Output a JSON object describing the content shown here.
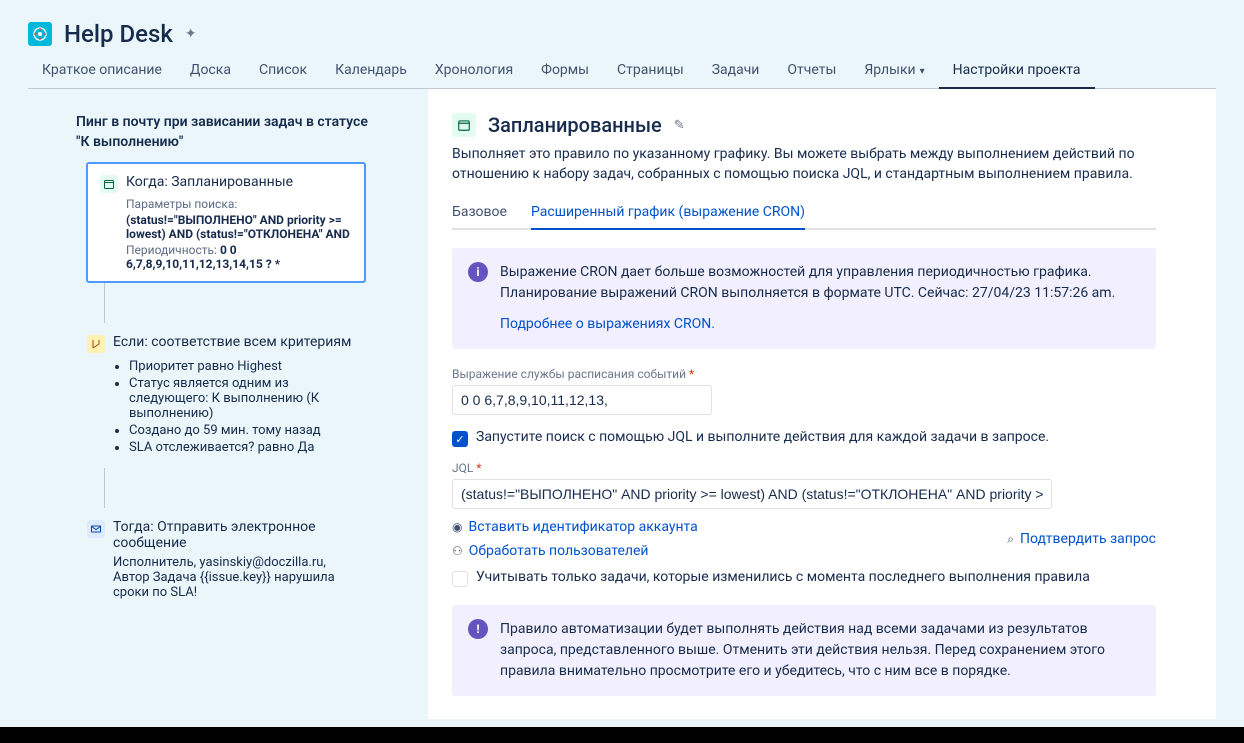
{
  "header": {
    "title": "Help Desk"
  },
  "tabs": {
    "items": [
      "Краткое описание",
      "Доска",
      "Список",
      "Календарь",
      "Хронология",
      "Формы",
      "Страницы",
      "Задачи",
      "Отчеты",
      "Ярлыки",
      "Настройки проекта"
    ],
    "active_index": 10,
    "dropdown_index": 9
  },
  "left": {
    "rule_title": "Пинг в почту при зависании задач в статусе \"К выполнению\"",
    "when": {
      "title": "Когда: Запланированные",
      "params_label": "Параметры поиска:",
      "jql": "(status!=\"ВЫПОЛНЕНО\" AND priority >= lowest) AND (status!=\"ОТКЛОНЕНА\" AND",
      "period_label": "Периодичность:",
      "period_value": "0 0 6,7,8,9,10,11,12,13,14,15 ? *"
    },
    "if": {
      "title": "Если: соответствие всем критериям",
      "bullets": [
        "Приоритет равно Highest",
        "Статус является одним из следующего: К выполнению (К выполнению)",
        "Создано до 59 мин. тому назад",
        "SLA отслеживается? равно Да"
      ]
    },
    "then": {
      "title": "Тогда: Отправить электронное сообщение",
      "body": "Исполнитель, yasinskiy@doczilla.ru, Автор Задача {{issue.key}} нарушила сроки по SLA!"
    }
  },
  "right": {
    "title": "Запланированные",
    "desc": "Выполняет это правило по указанному графику. Вы можете выбрать между выполнением действий по отношению к набору задач, собранных с помощью поиска JQL, и стандартным выполнением правила.",
    "subtabs": {
      "basic": "Базовое",
      "advanced": "Расширенный график (выражение CRON)"
    },
    "info_cron": "Выражение CRON дает больше возможностей для управления периодичностью графика. Планирование выражений CRON выполняется в формате UTC. Сейчас: 27/04/23 11:57:26 am.",
    "info_cron_link": "Подробнее о выражениях CRON.",
    "cron_label": "Выражение службы расписания событий",
    "cron_value": "0 0 6,7,8,9,10,11,12,13,",
    "run_jql_label": "Запустите поиск с помощью JQL и выполните действия для каждой задачи в запросе.",
    "jql_label": "JQL",
    "jql_value": "(status!=\"ВЫПОЛНЕНО\" AND priority >= lowest) AND (status!=\"ОТКЛОНЕНА\" AND priority >=",
    "insert_account": "Вставить идентификатор аккаунта",
    "process_users": "Обработать пользователей",
    "validate_query": "Подтвердить запрос",
    "only_changed_label": "Учитывать только задачи, которые изменились с момента последнего выполнения правила",
    "warning": "Правило автоматизации будет выполнять действия над всеми задачами из результатов запроса, представленного выше. Отменить эти действия нельзя. Перед сохранением этого правила внимательно просмотрите его и убедитесь, что с ним все в порядке."
  }
}
